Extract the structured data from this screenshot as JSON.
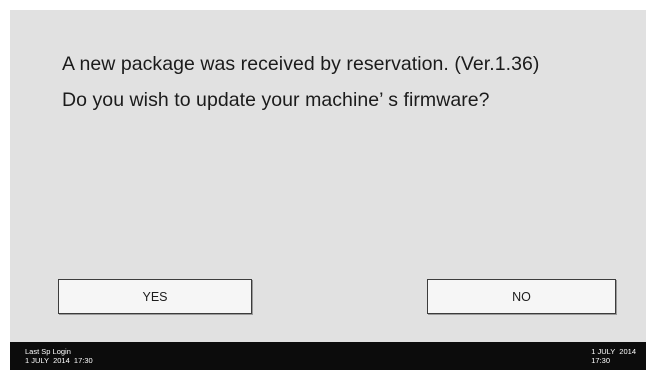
{
  "dialog": {
    "message_line1": "A new package was received by reservation. (Ver.1.36)",
    "message_line2": "Do you wish to update your machine’ s firmware?",
    "yes_label": "YES",
    "no_label": "NO"
  },
  "status_bar": {
    "left_title": "Last Sp Login",
    "left_datetime": "1 JULY  2014  17:30",
    "right_date": "1 JULY  2014",
    "right_time": "17:30"
  }
}
